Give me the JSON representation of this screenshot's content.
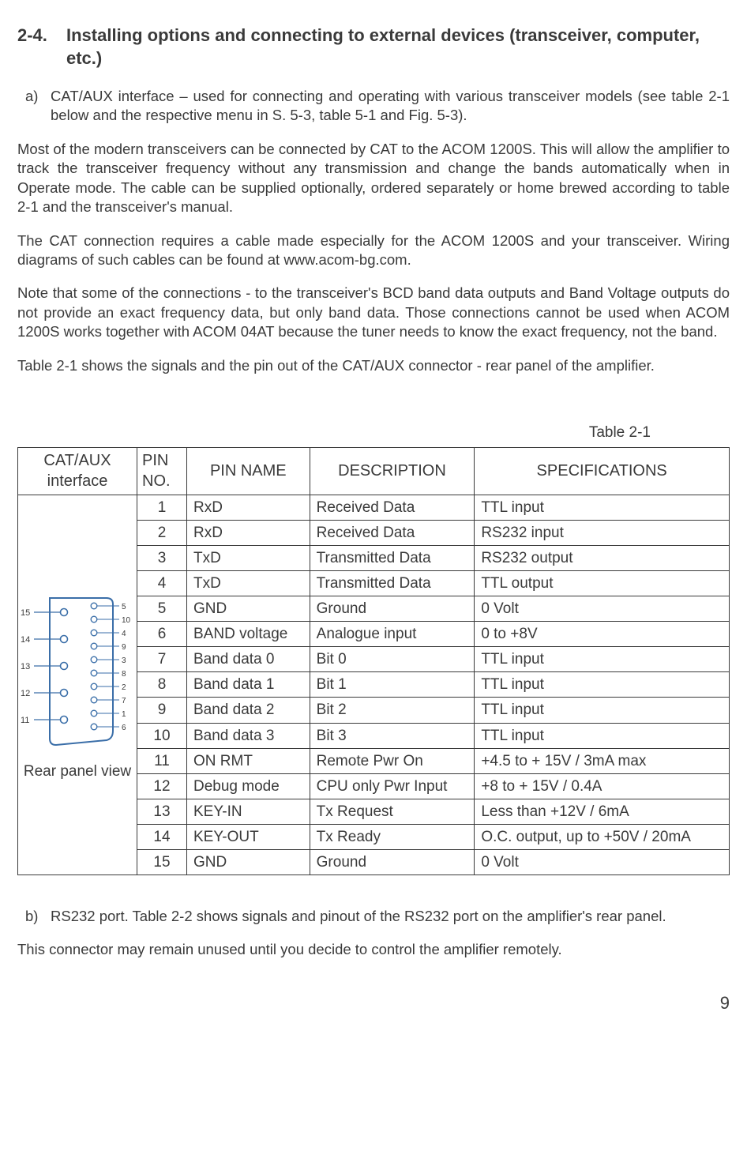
{
  "section": {
    "number": "2-4.",
    "title": "Installing options and connecting to external devices (transceiver, computer, etc.)"
  },
  "item_a": {
    "marker": "a)",
    "text": "CAT/AUX interface – used for connecting and operating with various transceiver models (see table 2-1 below and the respective menu in S. 5-3, table 5-1 and Fig. 5-3)."
  },
  "paragraphs": {
    "p1": "Most of the modern transceivers can be connected by CAT to the ACOM 1200S. This will allow the amplifier to track the transceiver frequency without any transmission and change the bands automatically when in Operate mode. The cable can be supplied optionally, ordered separately or home brewed according to table 2-1 and the transceiver's manual.",
    "p2": "The CAT connection requires a cable made especially for the ACOM 1200S and your transceiver. Wiring diagrams of such cables can be found at www.acom-bg.com.",
    "p3": "Note that some of the connections - to the transceiver's BCD band data outputs and Band Voltage outputs do not provide an exact frequency data, but only band data. Those connections cannot be used when ACOM 1200S works together with ACOM 04AT because the tuner needs to know the exact frequency, not the band.",
    "p4": "Table 2-1 shows the signals and the pin out of the CAT/AUX connector - rear panel of the amplifier."
  },
  "table_caption": "Table 2-1",
  "table": {
    "headers": {
      "col1": "CAT/AUX interface",
      "col2": "PIN NO.",
      "col3": "PIN NAME",
      "col4": "DESCRIPTION",
      "col5": "SPECIFICATIONS"
    },
    "diagram_label": "Rear panel view",
    "rows": [
      {
        "pin": "1",
        "name": "RxD",
        "desc": "Received Data",
        "spec": "TTL input"
      },
      {
        "pin": "2",
        "name": "RxD",
        "desc": "Received Data",
        "spec": "RS232 input"
      },
      {
        "pin": "3",
        "name": "TxD",
        "desc": "Transmitted Data",
        "spec": "RS232 output"
      },
      {
        "pin": "4",
        "name": "TxD",
        "desc": "Transmitted Data",
        "spec": "TTL output"
      },
      {
        "pin": "5",
        "name": "GND",
        "desc": "Ground",
        "spec": "0 Volt"
      },
      {
        "pin": "6",
        "name": "BAND voltage",
        "desc": "Analogue input",
        "spec": "0 to +8V"
      },
      {
        "pin": "7",
        "name": "Band data 0",
        "desc": "Bit 0",
        "spec": "TTL input"
      },
      {
        "pin": "8",
        "name": "Band data 1",
        "desc": "Bit 1",
        "spec": "TTL input"
      },
      {
        "pin": "9",
        "name": "Band data 2",
        "desc": "Bit 2",
        "spec": "TTL input"
      },
      {
        "pin": "10",
        "name": "Band data 3",
        "desc": "Bit 3",
        "spec": "TTL input"
      },
      {
        "pin": "11",
        "name": "ON RMT",
        "desc": "Remote Pwr On",
        "spec": "+4.5 to + 15V / 3mA max"
      },
      {
        "pin": "12",
        "name": "Debug mode",
        "desc": "CPU only Pwr Input",
        "spec": "+8 to + 15V / 0.4A"
      },
      {
        "pin": "13",
        "name": "KEY-IN",
        "desc": "Tx Request",
        "spec": "Less than +12V / 6mA"
      },
      {
        "pin": "14",
        "name": "KEY-OUT",
        "desc": "Tx Ready",
        "spec": "O.C. output, up to +50V / 20mA"
      },
      {
        "pin": "15",
        "name": "GND",
        "desc": "Ground",
        "spec": "0 Volt"
      }
    ]
  },
  "connector_pins": {
    "left": [
      "15",
      "14",
      "13",
      "12",
      "11"
    ],
    "right": [
      "5",
      "10",
      "4",
      "9",
      "3",
      "8",
      "2",
      "7",
      "1",
      "6"
    ]
  },
  "item_b": {
    "marker": "b)",
    "text": "RS232 port. Table 2-2 shows signals and pinout of the RS232 port on the amplifier's rear panel."
  },
  "closing": "This connector may remain unused until you decide to control the amplifier remotely.",
  "page_number": "9"
}
